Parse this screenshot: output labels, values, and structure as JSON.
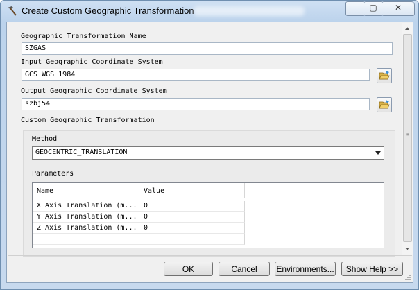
{
  "window": {
    "title": "Create Custom Geographic Transformation",
    "controls": {
      "minimize": "—",
      "maximize": "▢",
      "close": "✕"
    }
  },
  "form": {
    "name_label": "Geographic Transformation Name",
    "name_value": "SZGAS",
    "input_gcs_label": "Input Geographic Coordinate System",
    "input_gcs_value": "GCS_WGS_1984",
    "output_gcs_label": "Output Geographic Coordinate System",
    "output_gcs_value": "szbj54",
    "custom_label": "Custom Geographic Transformation",
    "method_label": "Method",
    "method_value": "GEOCENTRIC_TRANSLATION",
    "parameters_label": "Parameters",
    "table": {
      "headers": [
        "Name",
        "Value"
      ],
      "rows": [
        {
          "name": "X Axis Translation (m...",
          "value": "0"
        },
        {
          "name": "Y Axis Translation (m...",
          "value": "0"
        },
        {
          "name": "Z Axis Translation (m...",
          "value": "0"
        }
      ]
    }
  },
  "buttons": {
    "ok": "OK",
    "cancel": "Cancel",
    "environments": "Environments...",
    "show_help": "Show Help >>"
  },
  "icons": {
    "title": "hammer-icon",
    "browse": "open-folder-icon"
  }
}
